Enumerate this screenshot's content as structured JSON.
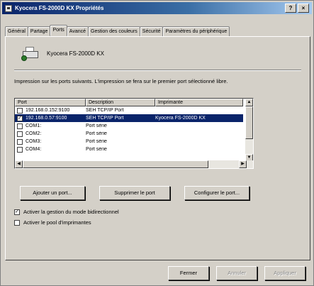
{
  "window": {
    "title": "Kyocera FS-2000D KX Propriétés",
    "help_label": "?",
    "close_label": "×"
  },
  "tabs": [
    {
      "label": "Général",
      "active": false
    },
    {
      "label": "Partage",
      "active": false
    },
    {
      "label": "Ports",
      "active": true
    },
    {
      "label": "Avancé",
      "active": false
    },
    {
      "label": "Gestion des couleurs",
      "active": false
    },
    {
      "label": "Sécurité",
      "active": false
    },
    {
      "label": "Paramètres du périphérique",
      "active": false
    }
  ],
  "printer": {
    "name": "Kyocera FS-2000D KX",
    "icon": "printer-icon"
  },
  "instructions": "Impression sur les ports suivants. L'impression se fera sur le premier port sélectionné libre.",
  "ports_table": {
    "columns": [
      "Port",
      "Description",
      "Imprimante"
    ],
    "rows": [
      {
        "checked": false,
        "port": "192.168.0.152:9100",
        "description": "SEH TCP/IP Port",
        "printer": "",
        "selected": false
      },
      {
        "checked": true,
        "port": "192.168.0.57:9100",
        "description": "SEH TCP/IP Port",
        "printer": "Kyocera FS-2000D KX",
        "selected": true
      },
      {
        "checked": false,
        "port": "COM1:",
        "description": "Port série",
        "printer": "",
        "selected": false
      },
      {
        "checked": false,
        "port": "COM2:",
        "description": "Port série",
        "printer": "",
        "selected": false
      },
      {
        "checked": false,
        "port": "COM3:",
        "description": "Port série",
        "printer": "",
        "selected": false
      },
      {
        "checked": false,
        "port": "COM4:",
        "description": "Port série",
        "printer": "",
        "selected": false
      }
    ]
  },
  "port_buttons": {
    "add": "Ajouter un port...",
    "delete": "Supprimer le port",
    "configure": "Configurer le port..."
  },
  "options": {
    "bidirectional": {
      "label": "Activer la gestion du mode bidirectionnel",
      "checked": true
    },
    "pooling": {
      "label": "Activer le pool d'imprimantes",
      "checked": false
    }
  },
  "footer": {
    "close": "Fermer",
    "apply": "Annuler",
    "apply2": "Appliquer"
  }
}
